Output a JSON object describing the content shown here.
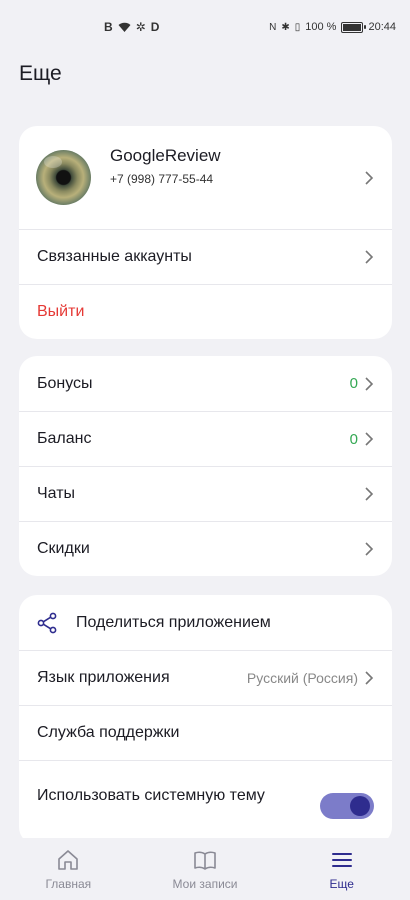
{
  "status_bar": {
    "left_icons": [
      "b-icon",
      "wifi-icon",
      "gear-icon",
      "d-icon"
    ],
    "right_text": "100 %",
    "time": "20:44"
  },
  "page": {
    "title": "Еще"
  },
  "profile": {
    "name": "GoogleReview",
    "phone": "+7 (998) 777-55-44"
  },
  "account": {
    "linked_accounts": "Связанные аккаунты",
    "logout": "Выйти"
  },
  "menu": {
    "bonuses": {
      "label": "Бонусы",
      "value": "0"
    },
    "balance": {
      "label": "Баланс",
      "value": "0"
    },
    "chats": {
      "label": "Чаты"
    },
    "discounts": {
      "label": "Скидки"
    }
  },
  "settings": {
    "share": "Поделиться приложением",
    "language_label": "Язык приложения",
    "language_value": "Русский (Россия)",
    "support": "Служба поддержки",
    "system_theme": "Использовать системную тему",
    "system_theme_on": true
  },
  "bottom_nav": {
    "home": "Главная",
    "records": "Мои записи",
    "more": "Еще"
  },
  "colors": {
    "accent": "#2e2c8e",
    "toggle_track": "#7c7cc9",
    "danger": "#e53935",
    "positive": "#34a853"
  }
}
